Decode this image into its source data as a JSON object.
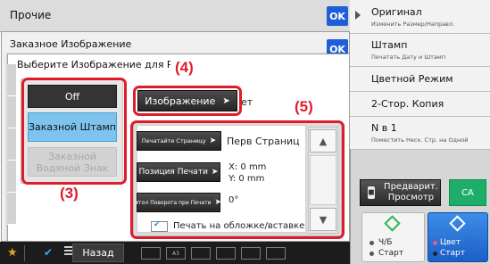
{
  "background": {
    "title": "Прочие",
    "ok_label": "OK"
  },
  "dialog_custom_image": {
    "title": "Заказное Изображение",
    "ok_label": "OK"
  },
  "dialog_select": {
    "title": "Выберите Изображение для Работы",
    "type_options": [
      {
        "label": "Off",
        "state": "selected-dark"
      },
      {
        "label": "Заказной Штамп",
        "state": "active"
      },
      {
        "label": "Заказной Водяной Знак",
        "state": "disabled"
      }
    ],
    "image_button_label": "Изображение",
    "trailing_text": "ет",
    "settings": {
      "page_print": {
        "button_label": "Печатайте Страницу",
        "value": "Перв Страниц"
      },
      "print_position": {
        "button_label": "Позиция Печати",
        "x_value": "X: 0 mm",
        "y_value": "Y: 0 mm"
      },
      "rotation": {
        "button_label": "Угол Поворота при Печати",
        "value": "0°"
      },
      "cover_checkbox": {
        "label": "Печать на обложке/вставке при",
        "checked": true
      }
    }
  },
  "callouts": {
    "left": "(3)",
    "image": "(4)",
    "settings": "(5)"
  },
  "bottom_bar": {
    "back_label": "Назад",
    "tray_label": "A3"
  },
  "right_panel": {
    "tabs": [
      {
        "title": "Оригинал",
        "subtitle": "Изменить Размер/Направл."
      },
      {
        "title": "Штамп",
        "subtitle": "Печатать Дату и Штамп"
      },
      {
        "title": "Цветной Режим",
        "subtitle": ""
      },
      {
        "title": "2-Стор. Копия",
        "subtitle": ""
      },
      {
        "title": "N в 1",
        "subtitle": "Поместить Неск. Стр. на Одной"
      }
    ],
    "preview_label": "Предварит. Просмотр",
    "ca_label": "CA",
    "start_bw": {
      "line1": "Ч/Б",
      "line2": "Старт"
    },
    "start_color": {
      "line1": "Цвет",
      "line2": "Старт"
    }
  },
  "colors": {
    "accent_blue": "#1f5ed8",
    "selected_option": "#7ec3ee",
    "annotation_red": "#e01c2a",
    "ca_green": "#1fae6a",
    "start_color_blue": "#1b5fc6"
  },
  "icons": [
    "star-icon",
    "checkmark-icon",
    "list-icon",
    "arrow-right-icon",
    "chevron-up-icon",
    "chevron-down-icon",
    "preview-icon",
    "start-diamond-icon",
    "tab-arrow-icon"
  ]
}
